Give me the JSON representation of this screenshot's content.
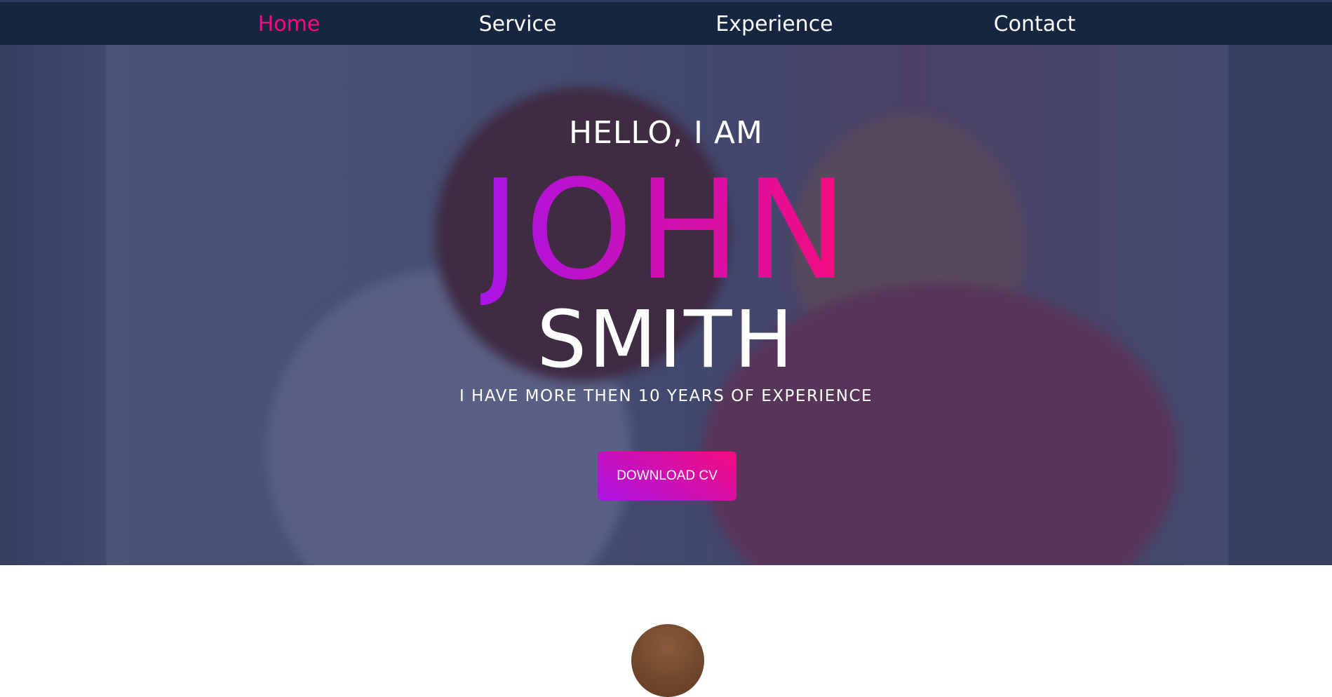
{
  "nav": {
    "items": [
      {
        "label": "Home",
        "active": true
      },
      {
        "label": "Service"
      },
      {
        "label": "Experience"
      },
      {
        "label": "Contact"
      }
    ],
    "active_color": "#f50c7c",
    "background": "#172640"
  },
  "hero": {
    "greeting": "HELLO, I AM",
    "first_name": "JOHN",
    "last_name": "SMITH",
    "tagline": "I HAVE MORE THEN 10 YEARS OF EXPERIENCE",
    "cta_label": "DOWNLOAD CV",
    "gradient": [
      "#a914e6",
      "#f50c7c"
    ]
  }
}
